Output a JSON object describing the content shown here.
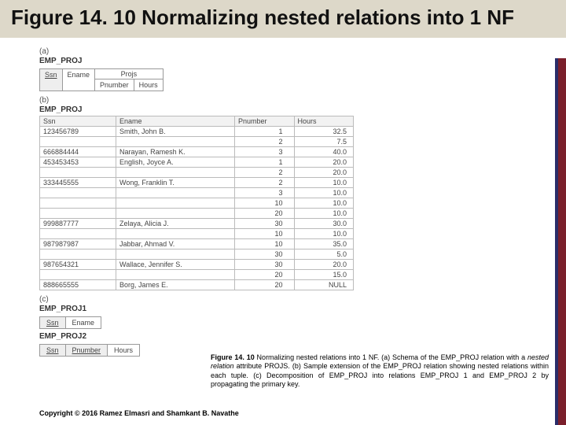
{
  "title": "Figure 14. 10 Normalizing nested relations into 1 NF",
  "parts": {
    "a": {
      "lbl": "(a)",
      "rel": "EMP_PROJ",
      "cols": {
        "ssn": "Ssn",
        "ename": "Ename",
        "projs": "Projs",
        "pnumber": "Pnumber",
        "hours": "Hours"
      }
    },
    "b": {
      "lbl": "(b)",
      "rel": "EMP_PROJ",
      "head": {
        "ssn": "Ssn",
        "ename": "Ename",
        "pnumber": "Pnumber",
        "hours": "Hours"
      },
      "rows": [
        {
          "ssn": "123456789",
          "ename": "Smith, John B.",
          "p": "1",
          "h": "32.5",
          "sep": true
        },
        {
          "ssn": "",
          "ename": "",
          "p": "2",
          "h": "7.5"
        },
        {
          "ssn": "666884444",
          "ename": "Narayan, Ramesh K.",
          "p": "3",
          "h": "40.0",
          "sep": true
        },
        {
          "ssn": "453453453",
          "ename": "English, Joyce A.",
          "p": "1",
          "h": "20.0",
          "sep": true
        },
        {
          "ssn": "",
          "ename": "",
          "p": "2",
          "h": "20.0"
        },
        {
          "ssn": "333445555",
          "ename": "Wong, Franklin T.",
          "p": "2",
          "h": "10.0",
          "sep": true
        },
        {
          "ssn": "",
          "ename": "",
          "p": "3",
          "h": "10.0"
        },
        {
          "ssn": "",
          "ename": "",
          "p": "10",
          "h": "10.0"
        },
        {
          "ssn": "",
          "ename": "",
          "p": "20",
          "h": "10.0"
        },
        {
          "ssn": "999887777",
          "ename": "Zelaya, Alicia J.",
          "p": "30",
          "h": "30.0",
          "sep": true
        },
        {
          "ssn": "",
          "ename": "",
          "p": "10",
          "h": "10.0"
        },
        {
          "ssn": "987987987",
          "ename": "Jabbar, Ahmad V.",
          "p": "10",
          "h": "35.0",
          "sep": true
        },
        {
          "ssn": "",
          "ename": "",
          "p": "30",
          "h": "5.0"
        },
        {
          "ssn": "987654321",
          "ename": "Wallace, Jennifer S.",
          "p": "30",
          "h": "20.0",
          "sep": true
        },
        {
          "ssn": "",
          "ename": "",
          "p": "20",
          "h": "15.0"
        },
        {
          "ssn": "888665555",
          "ename": "Borg, James E.",
          "p": "20",
          "h": "NULL",
          "sep": true
        }
      ]
    },
    "c": {
      "lbl": "(c)",
      "r1": {
        "name": "EMP_PROJ1",
        "cols": {
          "ssn": "Ssn",
          "ename": "Ename"
        }
      },
      "r2": {
        "name": "EMP_PROJ2",
        "cols": {
          "ssn": "Ssn",
          "pnumber": "Pnumber",
          "hours": "Hours"
        }
      }
    }
  },
  "caption": {
    "lead": "Figure 14. 10",
    "body": " Normalizing nested relations into 1 NF. (a) Schema of the EMP_PROJ relation with a ",
    "ital": "nested relation",
    "rest": " attribute PROJS. (b) Sample extension of the EMP_PROJ relation showing nested relations within each tuple. (c) Decomposition of EMP_PROJ into relations EMP_PROJ 1 and EMP_PROJ 2 by propagating the primary key."
  },
  "copyright": "Copyright © 2016 Ramez Elmasri and Shamkant B. Navathe"
}
